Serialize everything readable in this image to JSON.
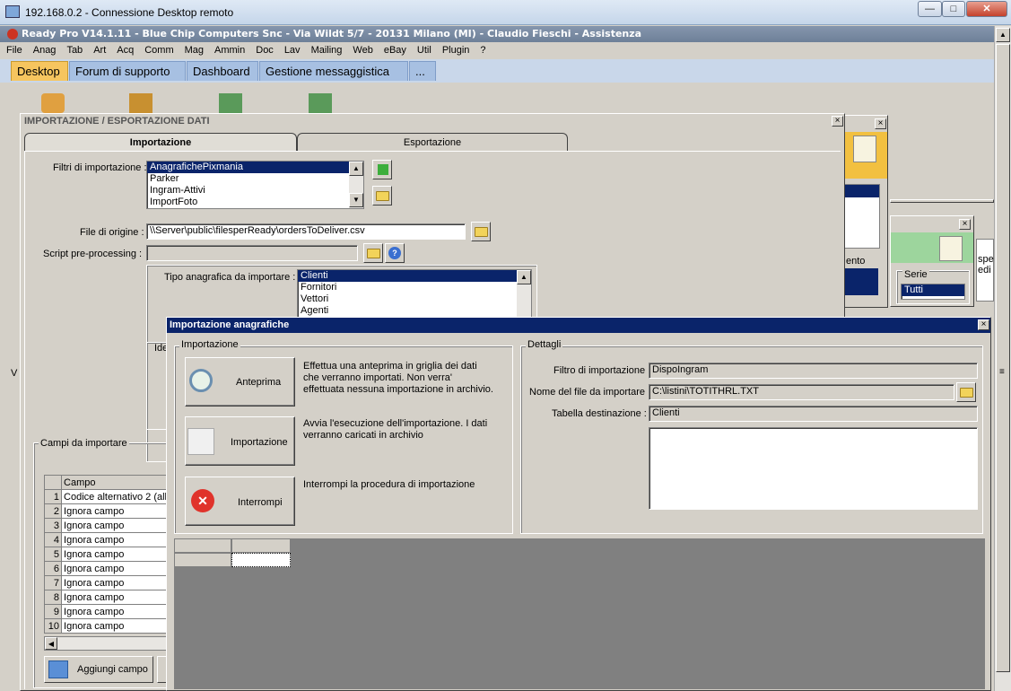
{
  "rdp": {
    "title": "192.168.0.2 - Connessione Desktop remoto"
  },
  "app": {
    "title": "Ready Pro V14.1.11 - Blue Chip Computers Snc - Via Wildt 5/7 - 20131 Milano (MI) - Claudio Fieschi - Assistenza"
  },
  "menu": [
    "File",
    "Anag",
    "Tab",
    "Art",
    "Acq",
    "Comm",
    "Mag",
    "Ammin",
    "Doc",
    "Lav",
    "Mailing",
    "Web",
    "eBay",
    "Util",
    "Plugin",
    "?"
  ],
  "desktop_tabs": [
    "Desktop",
    "Forum di supporto",
    "Dashboard",
    "Gestione messaggistica",
    "..."
  ],
  "bg": {
    "frag_ento": "ento",
    "frag_serie": "Serie",
    "frag_tutti": "Tutti",
    "frag_spe": "spe",
    "frag_edi": "edi",
    "frag_v": "V"
  },
  "ie_window": {
    "title": "IMPORTAZIONE / ESPORTAZIONE DATI",
    "tab_import": "Importazione",
    "tab_export": "Esportazione",
    "filters_label": "Filtri di importazione :",
    "filters": [
      "AnagrafichePixmania",
      "Parker",
      "Ingram-Attivi",
      "ImportFoto"
    ],
    "file_label": "File di origine :",
    "file_value": "\\\\Server\\public\\filesperReady\\ordersToDeliver.csv",
    "script_label": "Script pre-processing :",
    "script_value": "",
    "tipo_label": "Tipo anagrafica da importare :",
    "tipo": [
      "Clienti",
      "Fornitori",
      "Vettori",
      "Agenti"
    ],
    "ide_frag": "Ide",
    "campi_label": "Campi da importare",
    "grid_header": "Campo",
    "grid_rows": [
      {
        "n": "1",
        "campo": "Codice alternativo 2 (all"
      },
      {
        "n": "2",
        "campo": "Ignora campo"
      },
      {
        "n": "3",
        "campo": "Ignora campo"
      },
      {
        "n": "4",
        "campo": "Ignora campo"
      },
      {
        "n": "5",
        "campo": "Ignora campo"
      },
      {
        "n": "6",
        "campo": "Ignora campo"
      },
      {
        "n": "7",
        "campo": "Ignora campo"
      },
      {
        "n": "8",
        "campo": "Ignora campo"
      },
      {
        "n": "9",
        "campo": "Ignora campo"
      },
      {
        "n": "10",
        "campo": "Ignora campo"
      }
    ],
    "add_field": "Aggiungi campo"
  },
  "dialog": {
    "title": "Importazione anagrafiche",
    "group_import": "Importazione",
    "group_details": "Dettagli",
    "btn_preview": "Anteprima",
    "desc_preview": "Effettua una anteprima in griglia dei dati che verranno importati. Non verra' effettuata nessuna importazione in archivio.",
    "btn_import": "Importazione",
    "desc_import": "Avvia l'esecuzione dell'importazione. I dati verranno caricati in archivio",
    "btn_stop": "Interrompi",
    "desc_stop": "Interrompi la procedura di importazione",
    "filter_label": "Filtro di importazione :",
    "filter_value": "DispoIngram",
    "filename_label": "Nome del file da importare :",
    "filename_value": "C:\\listini\\TOTITHRL.TXT",
    "dest_label": "Tabella destinazione :",
    "dest_value": "Clienti",
    "notes": ""
  }
}
